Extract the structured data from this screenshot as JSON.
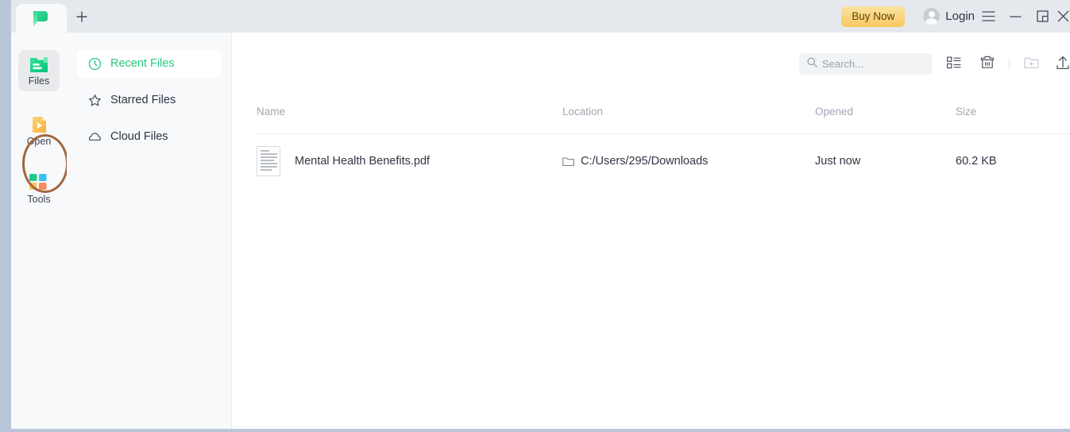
{
  "window": {
    "tab_logo_icon": "app-leaf-logo",
    "new_tab_icon": "plus-icon",
    "buy_now_label": "Buy Now",
    "login_label": "Login",
    "menu_icon": "hamburger-menu-icon",
    "minimize_icon": "minimize-icon",
    "restore_icon": "restore-window-icon",
    "close_icon": "close-icon"
  },
  "sidebar": {
    "items": [
      {
        "label": "Files",
        "icon": "green-folder-icon",
        "active": true
      },
      {
        "label": "Open",
        "icon": "open-document-icon",
        "active": false
      },
      {
        "label": "Tools",
        "icon": "grid-squares-icon",
        "active": false
      }
    ],
    "annotation": {
      "target": "Open",
      "shape": "ellipse",
      "color": "#a2663d"
    }
  },
  "nav": {
    "items": [
      {
        "label": "Recent Files",
        "icon": "clock-icon",
        "active": true
      },
      {
        "label": "Starred Files",
        "icon": "star-icon",
        "active": false
      },
      {
        "label": "Cloud Files",
        "icon": "cloud-icon",
        "active": false
      }
    ]
  },
  "toolbar": {
    "search": {
      "value": "",
      "placeholder": "Search...",
      "icon": "search-icon"
    },
    "list_view_icon": "list-view-icon",
    "trash_icon": "trash-icon",
    "new_folder_icon": "new-folder-icon",
    "upload_icon": "upload-icon"
  },
  "table": {
    "columns": [
      "Name",
      "Location",
      "Opened",
      "Size"
    ],
    "rows": [
      {
        "name": "Mental Health Benefits.pdf",
        "location": "C:/Users/295/Downloads",
        "opened": "Just now",
        "size": "60.2 KB",
        "file_icon": "pdf-document-icon",
        "location_icon": "folder-icon"
      }
    ]
  },
  "colors": {
    "accent_green": "#23c87f",
    "buy_now_gradient_start": "#fbe3a2",
    "buy_now_gradient_end": "#fbc75f",
    "annotation_brown": "#a2663d",
    "header_bg": "#e5e9ed",
    "panel_bg": "#f7f9fb"
  }
}
